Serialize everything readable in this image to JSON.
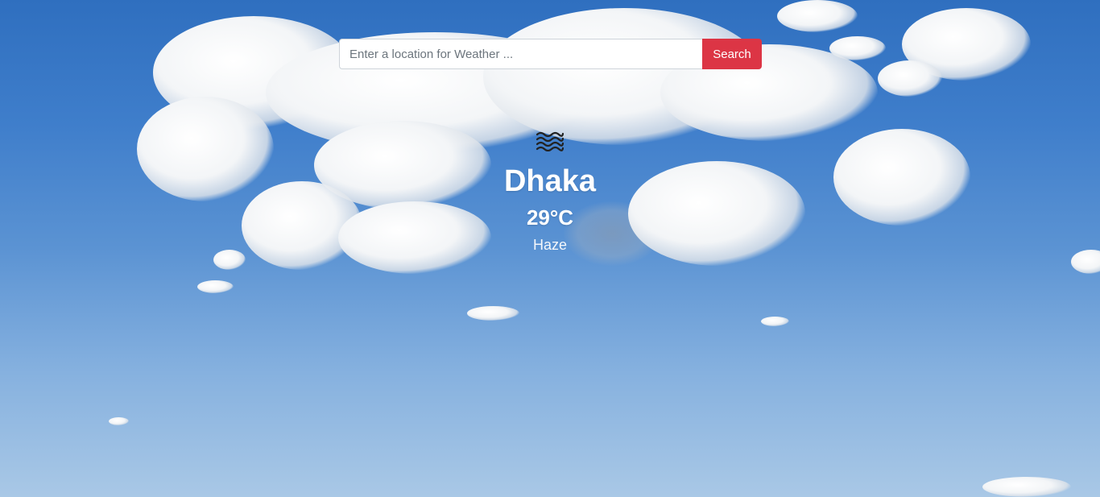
{
  "search": {
    "placeholder": "Enter a location for Weather ...",
    "value": "",
    "button_label": "Search",
    "button_color": "#dc3545"
  },
  "weather": {
    "icon": "haze-icon",
    "city": "Dhaka",
    "temperature": "29°C",
    "condition": "Haze"
  },
  "background": {
    "description_colors": {
      "sky_top": "#2f6fbf",
      "sky_bottom": "#a9c8e6"
    }
  }
}
